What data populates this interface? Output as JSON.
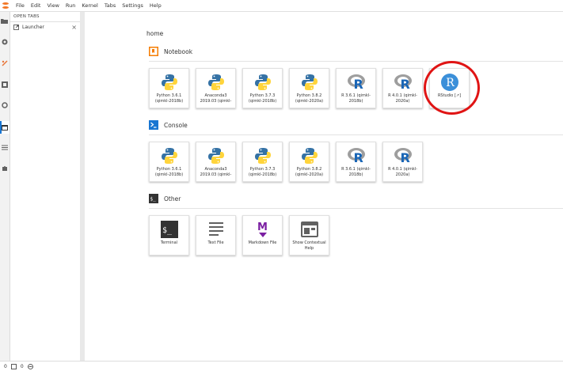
{
  "menubar": {
    "items": [
      "File",
      "Edit",
      "View",
      "Run",
      "Kernel",
      "Tabs",
      "Settings",
      "Help"
    ]
  },
  "left_sidebar": {
    "icons": [
      "folder-icon",
      "running-icon",
      "git-icon",
      "extension-manager-icon",
      "property-inspector-icon",
      "tabs-icon",
      "table-of-contents-icon",
      "puzzle-icon"
    ]
  },
  "open_tabs": {
    "header": "OPEN TABS",
    "items": [
      {
        "label": "Launcher",
        "close": "×"
      }
    ]
  },
  "launcher": {
    "breadcrumb": "home",
    "sections": [
      {
        "title": "Notebook",
        "icon": "notebook-icon",
        "cards": [
          {
            "label": "Python 3.6.1 (qimkl-2018b)",
            "icon": "python"
          },
          {
            "label": "Anaconda3 2019.03 (qimkl-",
            "icon": "python"
          },
          {
            "label": "Python 3.7.3 (qimkl-2018b)",
            "icon": "python"
          },
          {
            "label": "Python 3.8.2 (qimkl-2020a)",
            "icon": "python"
          },
          {
            "label": "R 3.6.1 (qimkl-2018b)",
            "icon": "r"
          },
          {
            "label": "R 4.0.1 (qimkl-2020a)",
            "icon": "r"
          },
          {
            "label": "RStudio [↗]",
            "icon": "rstudio"
          }
        ]
      },
      {
        "title": "Console",
        "icon": "console-icon",
        "cards": [
          {
            "label": "Python 3.6.1 (qimkl-2018b)",
            "icon": "python"
          },
          {
            "label": "Anaconda3 2019.03 (qimkl-",
            "icon": "python"
          },
          {
            "label": "Python 3.7.3 (qimkl-2018b)",
            "icon": "python"
          },
          {
            "label": "Python 3.8.2 (qimkl-2020a)",
            "icon": "python"
          },
          {
            "label": "R 3.6.1 (qimkl-2018b)",
            "icon": "r"
          },
          {
            "label": "R 4.0.1 (qimkl-2020a)",
            "icon": "r"
          }
        ]
      },
      {
        "title": "Other",
        "icon": "other-icon",
        "cards": [
          {
            "label": "Terminal",
            "icon": "terminal"
          },
          {
            "label": "Text File",
            "icon": "textfile"
          },
          {
            "label": "Markdown File",
            "icon": "markdown"
          },
          {
            "label": "Show Contextual Help",
            "icon": "help"
          }
        ]
      }
    ]
  },
  "statusbar": {
    "items": [
      "0",
      "0"
    ]
  },
  "colors": {
    "accent_orange": "#f57c00",
    "accent_blue": "#1976d2",
    "highlight_red": "#e01414",
    "python_blue": "#3572a5",
    "python_yellow": "#ffd43b"
  }
}
